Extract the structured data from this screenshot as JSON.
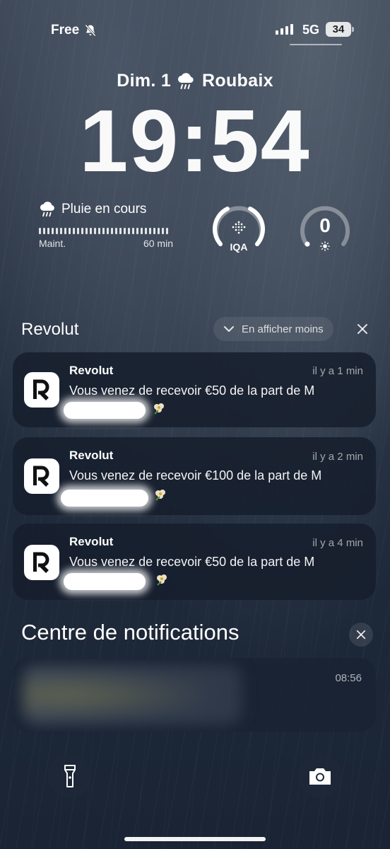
{
  "status_bar": {
    "carrier": "Free",
    "network": "5G",
    "battery": "34"
  },
  "lock": {
    "date": "Dim. 1",
    "city": "Roubaix",
    "time": "19:54"
  },
  "widgets": {
    "rain": {
      "title": "Pluie en cours",
      "start_label": "Maint.",
      "end_label": "60 min"
    },
    "aqi": {
      "label": "IQA"
    },
    "uv": {
      "value": "0"
    }
  },
  "group": {
    "title": "Revolut",
    "show_less": "En afficher moins"
  },
  "notifications": [
    {
      "app": "Revolut",
      "time": "il y a 1 min",
      "message": "Vous venez de recevoir €50 de la part de M"
    },
    {
      "app": "Revolut",
      "time": "il y a 2 min",
      "message": "Vous venez de recevoir €100 de la part de M"
    },
    {
      "app": "Revolut",
      "time": "il y a 4 min",
      "message": "Vous venez de recevoir €50 de la part de M"
    }
  ],
  "notification_center": {
    "title": "Centre de notifications",
    "card_time": "08:56"
  },
  "colors": {
    "background_top": "#3b4554",
    "background_bottom": "#1a2434",
    "card_bg": "#161e2c"
  }
}
